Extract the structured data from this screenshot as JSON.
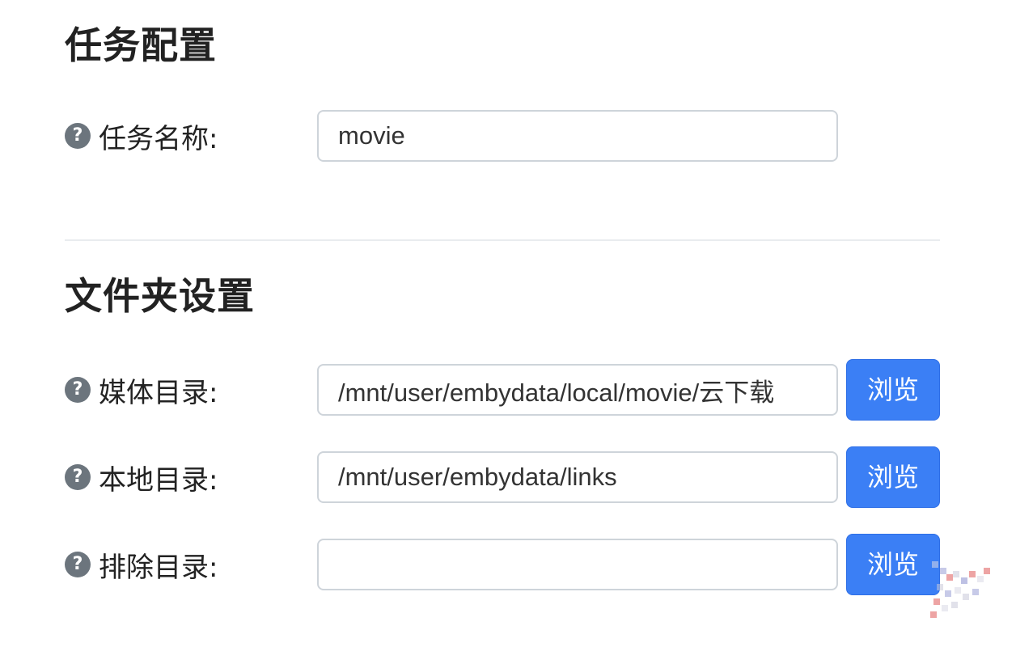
{
  "task_section": {
    "title": "任务配置",
    "fields": {
      "name": {
        "label": "任务名称:",
        "value": "movie"
      }
    }
  },
  "folder_section": {
    "title": "文件夹设置",
    "fields": {
      "media_dir": {
        "label": "媒体目录:",
        "value": "/mnt/user/embydata/local/movie/云下载",
        "button_label": "浏览"
      },
      "local_dir": {
        "label": "本地目录:",
        "value": "/mnt/user/embydata/links",
        "button_label": "浏览"
      },
      "exclude_dir": {
        "label": "排除目录:",
        "value": "",
        "button_label": "浏览"
      }
    }
  },
  "help_icon_glyph": "?",
  "icons": {
    "help": "question-circle-icon"
  },
  "colors": {
    "primary_button": "#3b7ff5",
    "help_icon": "#6c757d",
    "input_border": "#ced4da"
  }
}
